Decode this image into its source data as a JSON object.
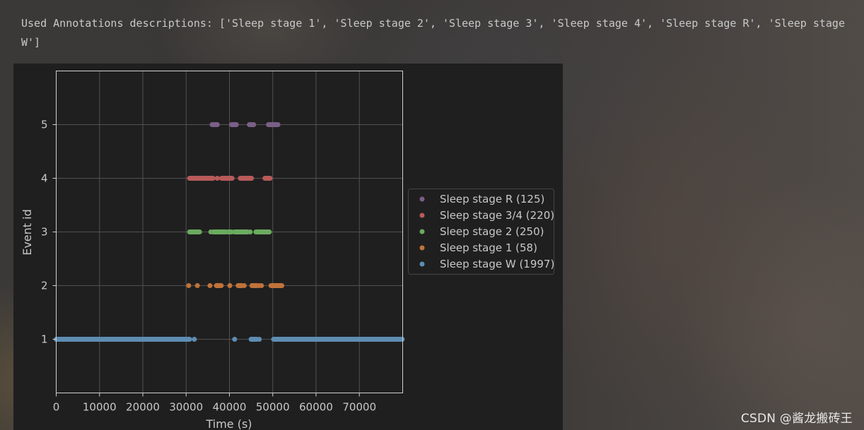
{
  "output": {
    "text": "Used Annotations descriptions: ['Sleep stage 1', 'Sleep stage 2', 'Sleep stage 3', 'Sleep stage 4', 'Sleep stage R', 'Sleep stage W']"
  },
  "watermark": {
    "text": "CSDN @酱龙搬砖王"
  },
  "chart_data": {
    "type": "scatter",
    "title": "",
    "xlabel": "Time (s)",
    "ylabel": "Event id",
    "xlim": [
      0,
      80000
    ],
    "ylim": [
      0,
      6
    ],
    "xticks": [
      0,
      10000,
      20000,
      30000,
      40000,
      50000,
      60000,
      70000
    ],
    "yticks": [
      1,
      2,
      3,
      4,
      5
    ],
    "grid": true,
    "legend_position": "center-right-outside",
    "series": [
      {
        "name": "Sleep stage R (125)",
        "event_id": 5,
        "color": "#7b5f87",
        "segments": [
          [
            36000,
            37200
          ],
          [
            40500,
            41600
          ],
          [
            44600,
            45600
          ],
          [
            49000,
            51200
          ]
        ],
        "points": []
      },
      {
        "name": "Sleep stage 3/4 (220)",
        "event_id": 4,
        "color": "#b85a5a",
        "segments": [
          [
            30800,
            36200
          ],
          [
            38200,
            40600
          ],
          [
            42500,
            45100
          ],
          [
            48200,
            49400
          ]
        ],
        "points": [
          37200
        ]
      },
      {
        "name": "Sleep stage 2 (250)",
        "event_id": 3,
        "color": "#6aaa5f",
        "segments": [
          [
            30800,
            31800
          ],
          [
            32100,
            33100
          ],
          [
            36300,
            39200
          ],
          [
            39700,
            40500
          ],
          [
            41200,
            44200
          ],
          [
            46100,
            49200
          ]
        ],
        "points": [
          35700,
          44800
        ]
      },
      {
        "name": "Sleep stage 1 (58)",
        "event_id": 2,
        "color": "#c0733a",
        "segments": [
          [
            37000,
            38100
          ],
          [
            42000,
            42800
          ],
          [
            45200,
            46300
          ],
          [
            49600,
            52100
          ]
        ],
        "points": [
          30600,
          32600,
          35500,
          40100,
          43400,
          46800,
          47400
        ]
      },
      {
        "name": "Sleep stage W (1997)",
        "event_id": 1,
        "color": "#5e8db3",
        "segments": [
          [
            0,
            30800
          ],
          [
            45000,
            46300
          ],
          [
            50200,
            79900
          ]
        ],
        "points": [
          31900,
          41200,
          46900
        ]
      }
    ]
  }
}
